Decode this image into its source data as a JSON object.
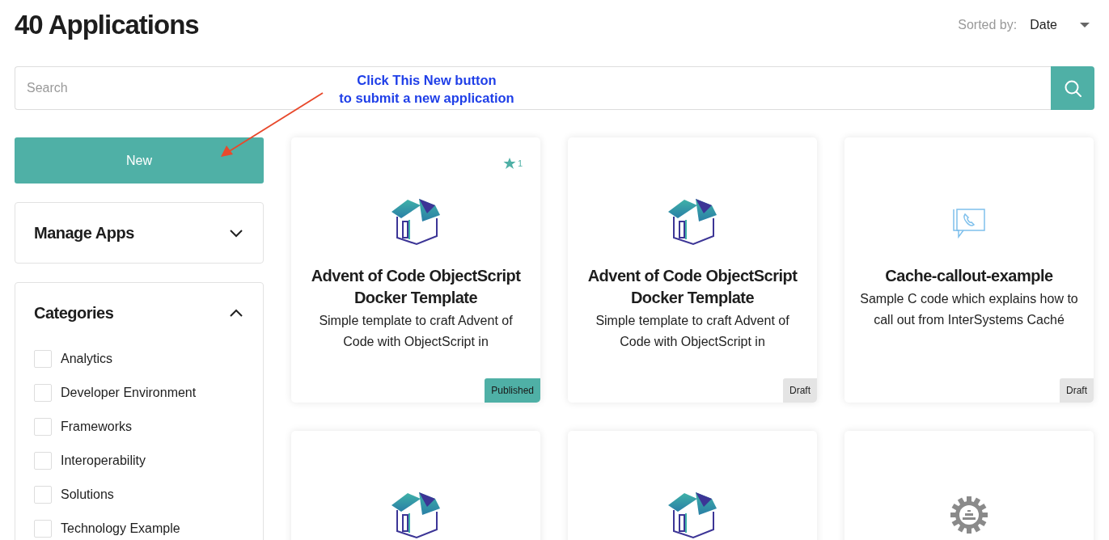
{
  "header": {
    "title": "40 Applications",
    "sort_label": "Sorted by:",
    "sort_value": "Date"
  },
  "search": {
    "placeholder": "Search"
  },
  "annotation": {
    "lines": [
      "Click This New button",
      "to submit a new application"
    ]
  },
  "new_button": "New",
  "manage_apps": {
    "title": "Manage Apps",
    "expanded": false
  },
  "categories": {
    "title": "Categories",
    "expanded": true,
    "items": [
      {
        "label": "Analytics",
        "checked": false
      },
      {
        "label": "Developer Environment",
        "checked": false
      },
      {
        "label": "Frameworks",
        "checked": false
      },
      {
        "label": "Interoperability",
        "checked": false
      },
      {
        "label": "Solutions",
        "checked": false
      },
      {
        "label": "Technology Example",
        "checked": false
      }
    ]
  },
  "apps": [
    {
      "kind": "box",
      "star_count": "1",
      "title": "Advent of Code ObjectScript Docker Template",
      "description": "Simple template to craft Advent of Code with ObjectScript in",
      "status": "Published",
      "published": true
    },
    {
      "kind": "box",
      "title": "Advent of Code ObjectScript Docker Template",
      "description": "Simple template to craft Advent of Code with ObjectScript in",
      "status": "Draft",
      "published": false
    },
    {
      "kind": "call",
      "title": "Cache-callout-example",
      "description": "Sample C code which explains how to call out from InterSystems Caché",
      "status": "Draft",
      "published": false
    },
    {
      "kind": "box"
    },
    {
      "kind": "box"
    },
    {
      "kind": "gear"
    }
  ]
}
